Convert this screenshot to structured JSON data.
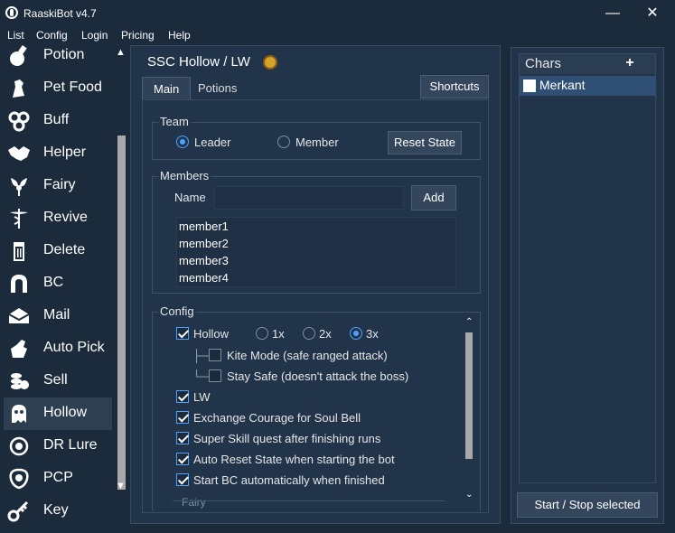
{
  "app": {
    "title": "RaaskiBot v4.7",
    "minimize": "—",
    "close": "✕"
  },
  "menu": [
    "List",
    "Config",
    "Login",
    "Pricing",
    "Help"
  ],
  "sidebar": {
    "items": [
      {
        "label": "Potion",
        "icon": "potion-icon"
      },
      {
        "label": "Pet Food",
        "icon": "pet-food-icon"
      },
      {
        "label": "Buff",
        "icon": "buff-icon"
      },
      {
        "label": "Helper",
        "icon": "handshake-icon"
      },
      {
        "label": "Fairy",
        "icon": "fairy-icon"
      },
      {
        "label": "Revive",
        "icon": "caduceus-icon"
      },
      {
        "label": "Delete",
        "icon": "trash-icon"
      },
      {
        "label": "BC",
        "icon": "horseshoe-icon"
      },
      {
        "label": "Mail",
        "icon": "mail-icon"
      },
      {
        "label": "Auto Pick",
        "icon": "hand-pick-icon"
      },
      {
        "label": "Sell",
        "icon": "coins-icon"
      },
      {
        "label": "Hollow",
        "icon": "ghost-icon",
        "active": true
      },
      {
        "label": "DR Lure",
        "icon": "lure-icon"
      },
      {
        "label": "PCP",
        "icon": "pcp-icon"
      },
      {
        "label": "Key",
        "icon": "key-icon"
      }
    ]
  },
  "main": {
    "title": "SSC Hollow / LW",
    "tabs": [
      "Main",
      "Potions"
    ],
    "shortcuts": "Shortcuts",
    "team": {
      "title": "Team",
      "leader": "Leader",
      "member": "Member",
      "selected": "Leader",
      "reset": "Reset State"
    },
    "members": {
      "title": "Members",
      "name_label": "Name",
      "name_value": "",
      "add": "Add",
      "list": [
        "member1",
        "member2",
        "member3",
        "member4"
      ]
    },
    "config": {
      "title": "Config",
      "hollow": "Hollow",
      "multipliers": [
        "1x",
        "2x",
        "3x"
      ],
      "selected_multiplier": "3x",
      "kite": "Kite Mode (safe ranged attack)",
      "stay_safe": "Stay Safe (doesn't attack the boss)",
      "lw": "LW",
      "exchange": "Exchange Courage for Soul Bell",
      "super_skill": "Super Skill quest after finishing runs",
      "auto_reset": "Auto Reset State when starting the bot",
      "start_bc": "Start BC automatically when finished",
      "fairy_partial": "Fairy"
    }
  },
  "right": {
    "header": "Chars",
    "add": "+",
    "chars": [
      "Merkant"
    ],
    "start_stop": "Start / Stop selected"
  },
  "colors": {
    "bg": "#1c2b3c",
    "panel": "#22344a",
    "accent": "#4da3ff",
    "selected_row": "#2f5074"
  }
}
